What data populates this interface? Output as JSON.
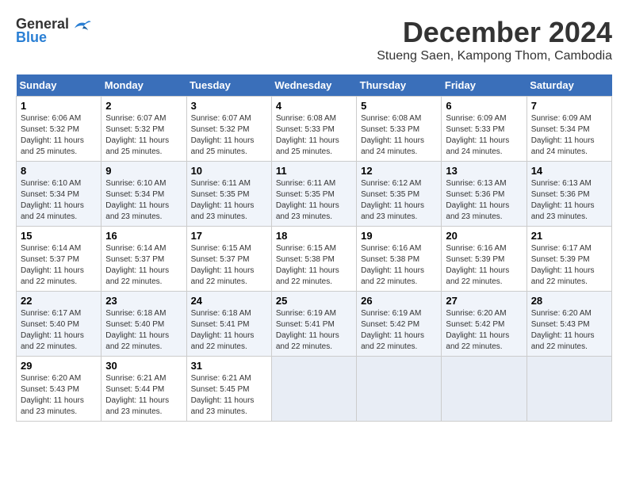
{
  "header": {
    "logo_general": "General",
    "logo_blue": "Blue",
    "month_title": "December 2024",
    "location": "Stueng Saen, Kampong Thom, Cambodia"
  },
  "weekdays": [
    "Sunday",
    "Monday",
    "Tuesday",
    "Wednesday",
    "Thursday",
    "Friday",
    "Saturday"
  ],
  "weeks": [
    [
      {
        "day": "1",
        "sunrise": "6:06 AM",
        "sunset": "5:32 PM",
        "daylight": "11 hours and 25 minutes."
      },
      {
        "day": "2",
        "sunrise": "6:07 AM",
        "sunset": "5:32 PM",
        "daylight": "11 hours and 25 minutes."
      },
      {
        "day": "3",
        "sunrise": "6:07 AM",
        "sunset": "5:32 PM",
        "daylight": "11 hours and 25 minutes."
      },
      {
        "day": "4",
        "sunrise": "6:08 AM",
        "sunset": "5:33 PM",
        "daylight": "11 hours and 25 minutes."
      },
      {
        "day": "5",
        "sunrise": "6:08 AM",
        "sunset": "5:33 PM",
        "daylight": "11 hours and 24 minutes."
      },
      {
        "day": "6",
        "sunrise": "6:09 AM",
        "sunset": "5:33 PM",
        "daylight": "11 hours and 24 minutes."
      },
      {
        "day": "7",
        "sunrise": "6:09 AM",
        "sunset": "5:34 PM",
        "daylight": "11 hours and 24 minutes."
      }
    ],
    [
      {
        "day": "8",
        "sunrise": "6:10 AM",
        "sunset": "5:34 PM",
        "daylight": "11 hours and 24 minutes."
      },
      {
        "day": "9",
        "sunrise": "6:10 AM",
        "sunset": "5:34 PM",
        "daylight": "11 hours and 23 minutes."
      },
      {
        "day": "10",
        "sunrise": "6:11 AM",
        "sunset": "5:35 PM",
        "daylight": "11 hours and 23 minutes."
      },
      {
        "day": "11",
        "sunrise": "6:11 AM",
        "sunset": "5:35 PM",
        "daylight": "11 hours and 23 minutes."
      },
      {
        "day": "12",
        "sunrise": "6:12 AM",
        "sunset": "5:35 PM",
        "daylight": "11 hours and 23 minutes."
      },
      {
        "day": "13",
        "sunrise": "6:13 AM",
        "sunset": "5:36 PM",
        "daylight": "11 hours and 23 minutes."
      },
      {
        "day": "14",
        "sunrise": "6:13 AM",
        "sunset": "5:36 PM",
        "daylight": "11 hours and 23 minutes."
      }
    ],
    [
      {
        "day": "15",
        "sunrise": "6:14 AM",
        "sunset": "5:37 PM",
        "daylight": "11 hours and 22 minutes."
      },
      {
        "day": "16",
        "sunrise": "6:14 AM",
        "sunset": "5:37 PM",
        "daylight": "11 hours and 22 minutes."
      },
      {
        "day": "17",
        "sunrise": "6:15 AM",
        "sunset": "5:37 PM",
        "daylight": "11 hours and 22 minutes."
      },
      {
        "day": "18",
        "sunrise": "6:15 AM",
        "sunset": "5:38 PM",
        "daylight": "11 hours and 22 minutes."
      },
      {
        "day": "19",
        "sunrise": "6:16 AM",
        "sunset": "5:38 PM",
        "daylight": "11 hours and 22 minutes."
      },
      {
        "day": "20",
        "sunrise": "6:16 AM",
        "sunset": "5:39 PM",
        "daylight": "11 hours and 22 minutes."
      },
      {
        "day": "21",
        "sunrise": "6:17 AM",
        "sunset": "5:39 PM",
        "daylight": "11 hours and 22 minutes."
      }
    ],
    [
      {
        "day": "22",
        "sunrise": "6:17 AM",
        "sunset": "5:40 PM",
        "daylight": "11 hours and 22 minutes."
      },
      {
        "day": "23",
        "sunrise": "6:18 AM",
        "sunset": "5:40 PM",
        "daylight": "11 hours and 22 minutes."
      },
      {
        "day": "24",
        "sunrise": "6:18 AM",
        "sunset": "5:41 PM",
        "daylight": "11 hours and 22 minutes."
      },
      {
        "day": "25",
        "sunrise": "6:19 AM",
        "sunset": "5:41 PM",
        "daylight": "11 hours and 22 minutes."
      },
      {
        "day": "26",
        "sunrise": "6:19 AM",
        "sunset": "5:42 PM",
        "daylight": "11 hours and 22 minutes."
      },
      {
        "day": "27",
        "sunrise": "6:20 AM",
        "sunset": "5:42 PM",
        "daylight": "11 hours and 22 minutes."
      },
      {
        "day": "28",
        "sunrise": "6:20 AM",
        "sunset": "5:43 PM",
        "daylight": "11 hours and 22 minutes."
      }
    ],
    [
      {
        "day": "29",
        "sunrise": "6:20 AM",
        "sunset": "5:43 PM",
        "daylight": "11 hours and 23 minutes."
      },
      {
        "day": "30",
        "sunrise": "6:21 AM",
        "sunset": "5:44 PM",
        "daylight": "11 hours and 23 minutes."
      },
      {
        "day": "31",
        "sunrise": "6:21 AM",
        "sunset": "5:45 PM",
        "daylight": "11 hours and 23 minutes."
      },
      null,
      null,
      null,
      null
    ]
  ],
  "labels": {
    "sunrise": "Sunrise: ",
    "sunset": "Sunset: ",
    "daylight": "Daylight: "
  }
}
